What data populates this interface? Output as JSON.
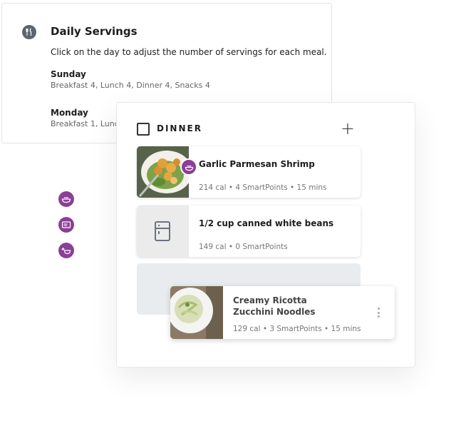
{
  "servings": {
    "title": "Daily Servings",
    "description": "Click on the day to adjust the number of servings for each meal.",
    "days": [
      {
        "name": "Sunday",
        "meals": "Breakfast 4, Lunch 4, Dinner 4, Snacks 4"
      },
      {
        "name": "Monday",
        "meals": "Breakfast 1, Lunch"
      }
    ],
    "icon": "utensils-icon"
  },
  "side_icons": [
    "bowl-icon",
    "microwave-icon",
    "bowl-plus-icon"
  ],
  "dinner": {
    "label": "DINNER",
    "add_label": "+",
    "items": [
      {
        "name": "Garlic Parmesan Shrimp",
        "meta": "214 cal  •  4 SmartPoints  •  15 mins",
        "badge_icon": "bowl-icon"
      },
      {
        "name": "1/2 cup canned white beans",
        "meta": "149 cal  •  0 SmartPoints",
        "icon": "fridge-icon"
      }
    ],
    "dragging": {
      "name": "Creamy Ricotta Zucchini Noodles",
      "meta": "129 cal  •  3 SmartPoints  •  15 mins"
    }
  },
  "colors": {
    "accent": "#8b3f96",
    "icon_gray": "#5d6470",
    "drop_zone": "#e9ecef"
  }
}
